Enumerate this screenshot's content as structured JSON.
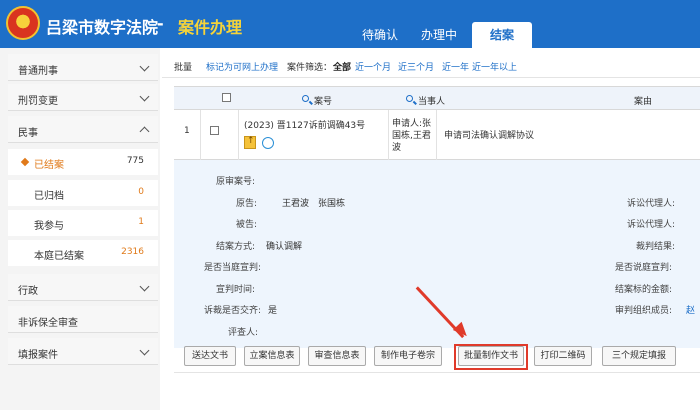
{
  "header": {
    "app_title": "吕梁市数字法院",
    "separator": "-",
    "module_title": "案件办理",
    "tabs": [
      {
        "label": "待确认"
      },
      {
        "label": "办理中"
      },
      {
        "label": "结案"
      }
    ]
  },
  "sidebar": {
    "items": [
      {
        "label": "普通刑事"
      },
      {
        "label": "刑罚变更"
      },
      {
        "label": "民事"
      },
      {
        "label": "行政"
      },
      {
        "label": "非诉保全审查"
      },
      {
        "label": "填报案件"
      }
    ],
    "sub_items": [
      {
        "label": "已结案",
        "count": "775"
      },
      {
        "label": "已归档",
        "count": "0"
      },
      {
        "label": "我参与",
        "count": "1"
      },
      {
        "label": "本庭已结案",
        "count": "2316"
      }
    ]
  },
  "toolbar": {
    "batch": "批量",
    "mark_online": "标记为可网上办理",
    "filter_label": "案件筛选：",
    "filter_all": "全部",
    "filter_1m": "近一个月",
    "filter_3m": "近三个月",
    "filter_1y": "近一年",
    "filter_1y_plus": "近一年以上"
  },
  "table": {
    "headers": {
      "case_no": "案号",
      "party": "当事人",
      "cause": "案由"
    },
    "row": {
      "index": "1",
      "case_no": "(2023) 晋1127诉前调确43号",
      "party": "申请人:张国栋,王君波",
      "cause": "申请司法确认调解协议"
    }
  },
  "detail": {
    "original_case_no": "原审案号:",
    "plaintiff_label": "原告:",
    "plaintiff_value": "王君波　张国栋",
    "defendant_label": "被告:",
    "closing_method_label": "结案方式:",
    "closing_method_value": "确认调解",
    "public_hearing_label": "是否当庭宣判:",
    "announce_time_label": "宣判时间:",
    "exchange_label": "诉裁是否交齐:",
    "exchange_value": "是",
    "assessor_label": "评查人:",
    "agent_label_1": "诉讼代理人:",
    "agent_label_2": "诉讼代理人:",
    "judgment_result_label": "裁判结果:",
    "written_judgment_label": "是否说庭宣判:",
    "closing_amount_label": "结案标的金额:",
    "trial_org_label": "审判组织成员:",
    "trial_org_value": "赵"
  },
  "buttons": {
    "deliver": "送达文书",
    "case_info": "立案信息表",
    "trial_info": "审查信息表",
    "e_dossier": "制作电子卷宗",
    "batch_make": "批量制作文书",
    "print_qr": "打印二维码",
    "three_rules": "三个规定填报"
  },
  "colors": {
    "header_blue": "#1e6fc8",
    "accent_orange": "#e07a1a",
    "highlight_red": "#e03a2a",
    "title_yellow": "#f5d33a"
  }
}
